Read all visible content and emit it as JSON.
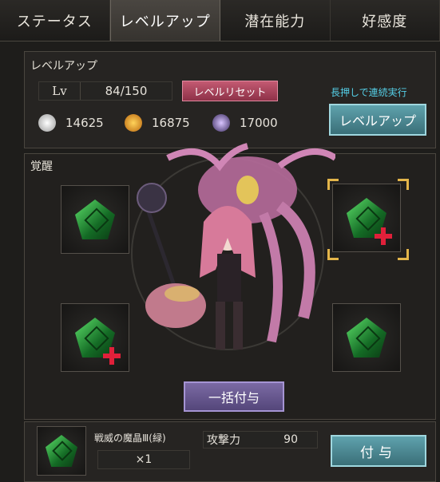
{
  "tabs": [
    {
      "label": "ステータス"
    },
    {
      "label": "レベルアップ",
      "active": true
    },
    {
      "label": "潜在能力"
    },
    {
      "label": "好感度"
    }
  ],
  "levelup": {
    "section_title": "レベルアップ",
    "lv_label": "Lv",
    "lv_value": "84/150",
    "reset_button": "レベルリセット",
    "hold_hint": "長押しで連続実行",
    "levelup_button": "レベルアップ",
    "resources": [
      {
        "icon": "silver-coin-icon",
        "value": "14625"
      },
      {
        "icon": "gold-coin-icon",
        "value": "16875"
      },
      {
        "icon": "purple-orb-icon",
        "value": "17000"
      }
    ]
  },
  "awakening": {
    "section_title": "覚醒",
    "bulk_button": "一括付与",
    "slots": [
      {
        "name": "top-left",
        "gem": "green-rune-gem-icon",
        "plus": false,
        "selected": false
      },
      {
        "name": "top-right",
        "gem": "green-rune-gem-icon",
        "plus": true,
        "selected": true
      },
      {
        "name": "bottom-left",
        "gem": "green-rune-gem-icon",
        "plus": true,
        "selected": false
      },
      {
        "name": "bottom-right",
        "gem": "green-rune-gem-icon",
        "plus": false,
        "selected": false
      }
    ]
  },
  "selected_item": {
    "name": "戦威の魔晶Ⅲ(緑)",
    "quantity": "×1",
    "stat_label": "攻撃力",
    "stat_value": "90",
    "grant_button": "付与"
  },
  "colors": {
    "accent_cyan": "#55d0e8",
    "reset_pink": "#c35a72",
    "bulk_purple": "#7b6aa4",
    "levelup_teal": "#5fa2ad",
    "plus_red": "#e0203a",
    "select_gold": "#e3b54a"
  }
}
